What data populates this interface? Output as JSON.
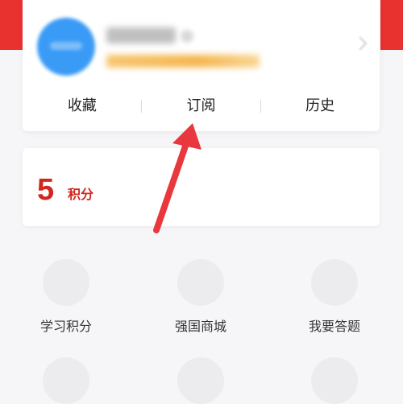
{
  "colors": {
    "brand_red": "#e8322f",
    "points_red": "#d0271f",
    "avatar_blue": "#3a9bf6",
    "annotation_arrow": "#e8383d"
  },
  "profile": {
    "name": "",
    "subtitle": ""
  },
  "tabs": [
    {
      "label": "收藏"
    },
    {
      "label": "订阅"
    },
    {
      "label": "历史"
    }
  ],
  "points": {
    "value": "5",
    "unit": "积分"
  },
  "menu": [
    {
      "label": "学习积分",
      "icon": "study-points-icon"
    },
    {
      "label": "强国商城",
      "icon": "mall-icon"
    },
    {
      "label": "我要答题",
      "icon": "quiz-icon"
    }
  ],
  "annotation": {
    "icon": "red-arrow-icon",
    "target": "tab-subscribe"
  }
}
